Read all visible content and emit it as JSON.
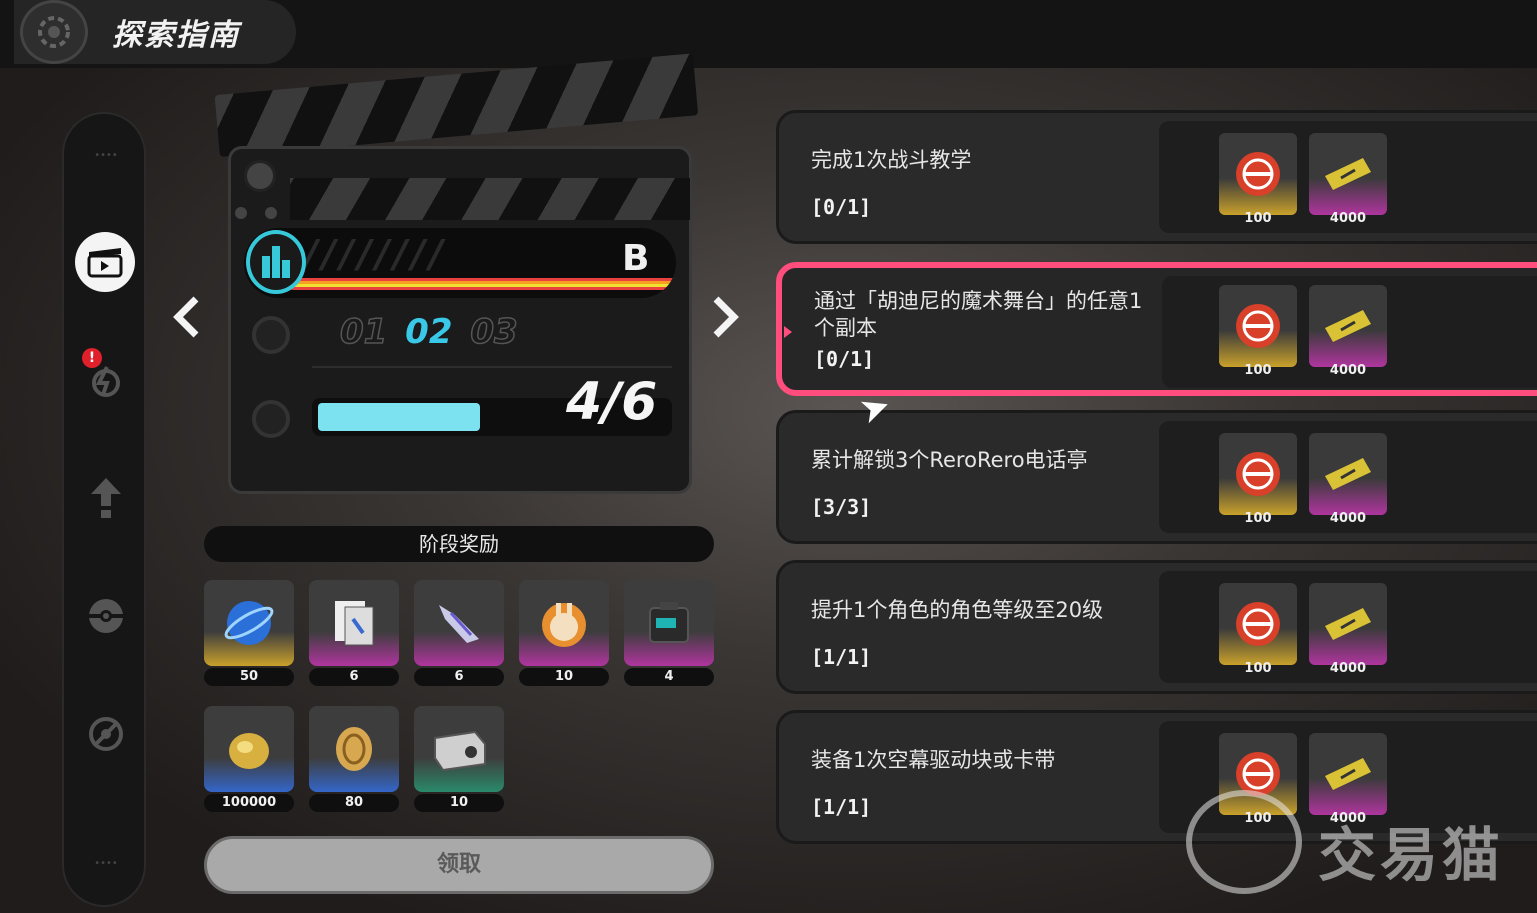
{
  "header": {
    "title": "探索指南"
  },
  "sidebar": {
    "items": [
      {
        "icon": "clapperboard-icon",
        "active": true
      },
      {
        "icon": "profile-bolt-icon",
        "badge": "!"
      },
      {
        "icon": "upgrade-arrow-icon"
      },
      {
        "icon": "pokeball-icon"
      },
      {
        "icon": "circle-slash-icon"
      }
    ]
  },
  "clapper": {
    "grade": "B",
    "stages": [
      "01",
      "02",
      "03"
    ],
    "current_stage": "02",
    "progress_text": "4/6",
    "progress_fraction": 0.6667
  },
  "stage_rewards": {
    "header": "阶段奖励",
    "items": [
      {
        "icon": "blue-orb-icon",
        "count": "50",
        "rarity": "gold"
      },
      {
        "icon": "document-card-icon",
        "count": "6",
        "rarity": "purple"
      },
      {
        "icon": "crystal-shard-icon",
        "count": "6",
        "rarity": "purple"
      },
      {
        "icon": "bunny-coin-icon",
        "count": "10",
        "rarity": "purple"
      },
      {
        "icon": "cube-box-icon",
        "count": "4",
        "rarity": "purple"
      },
      {
        "icon": "gold-egg-icon",
        "count": "100000",
        "rarity": "blue"
      },
      {
        "icon": "bronze-coin-icon",
        "count": "80",
        "rarity": "blue"
      },
      {
        "icon": "metal-case-icon",
        "count": "10",
        "rarity": "green"
      }
    ],
    "claim_label": "领取"
  },
  "tasks": [
    {
      "title": "完成1次战斗教学",
      "progress": "[0/1]",
      "r1": "100",
      "r2": "4000",
      "active": false
    },
    {
      "title": "通过「胡迪尼的魔术舞台」的任意1个副本",
      "progress": "[0/1]",
      "r1": "100",
      "r2": "4000",
      "active": true
    },
    {
      "title": "累计解锁3个ReroRero电话亭",
      "progress": "[3/3]",
      "r1": "100",
      "r2": "4000",
      "active": false
    },
    {
      "title": "提升1个角色的角色等级至20级",
      "progress": "[1/1]",
      "r1": "100",
      "r2": "4000",
      "active": false
    },
    {
      "title": "装备1次空幕驱动块或卡带",
      "progress": "[1/1]",
      "r1": "100",
      "r2": "4000",
      "active": false
    }
  ],
  "watermark": {
    "text": "交易猫"
  },
  "colors": {
    "accent_pink": "#ff4d7e",
    "progress_cyan": "#7ce2ef",
    "stage_cyan": "#3ac8e8"
  }
}
